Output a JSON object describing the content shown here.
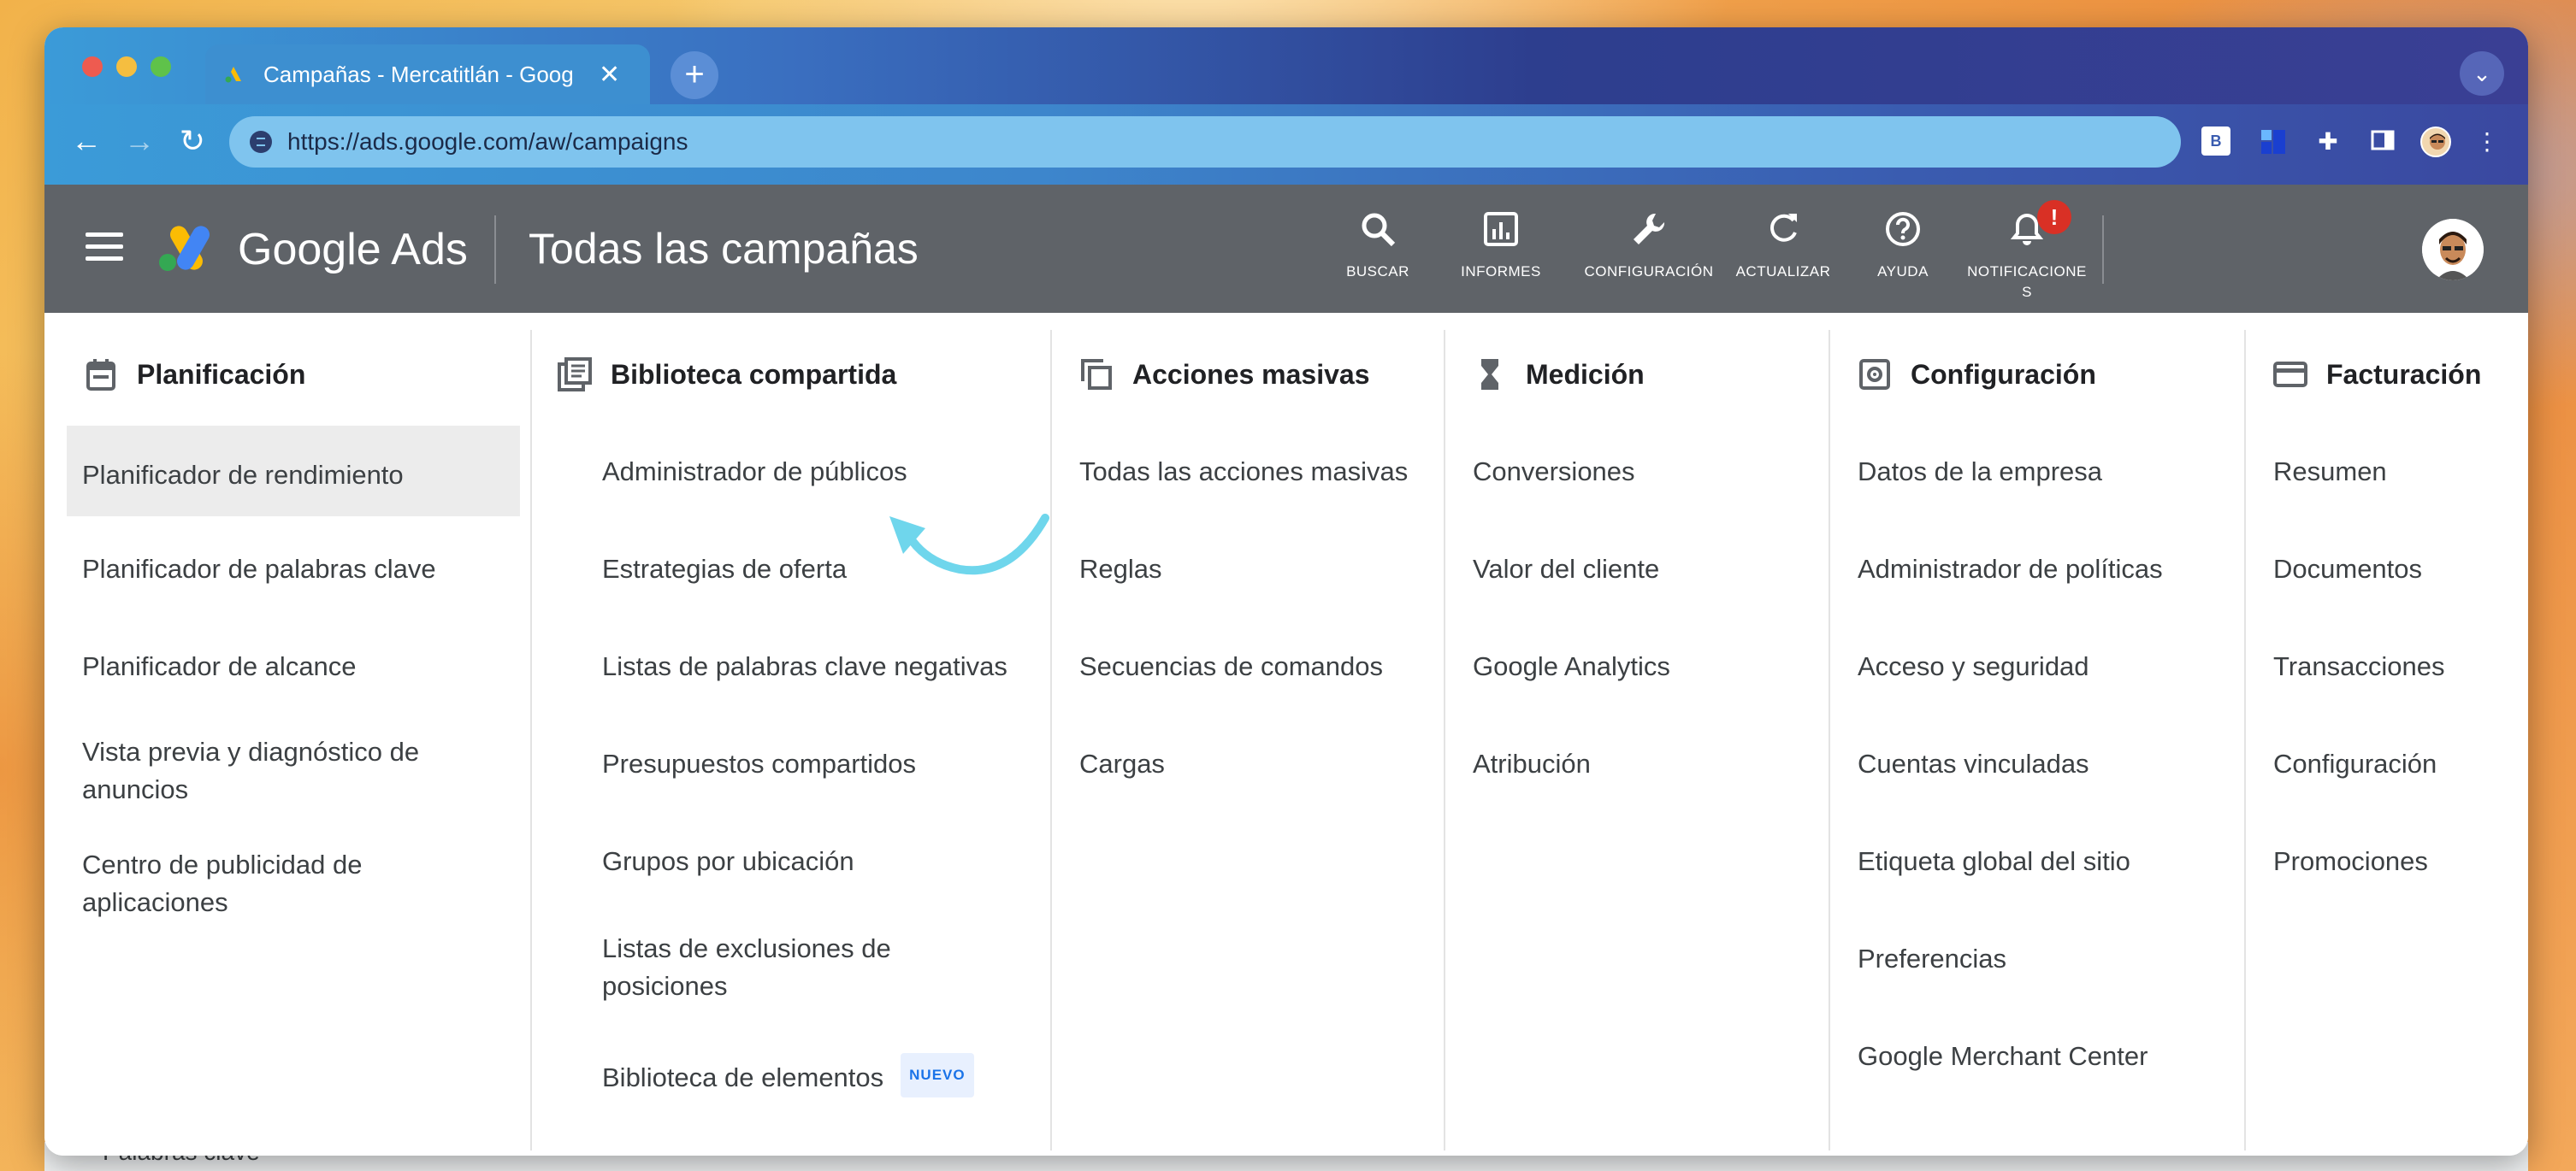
{
  "browser": {
    "tab_title": "Campañas - Mercatitlán - Goog",
    "url": "https://ads.google.com/aw/campaigns",
    "ext_b_label": "B"
  },
  "header": {
    "brand": "Google Ads",
    "page_title": "Todas las campañas",
    "actions": [
      {
        "label": "BUSCAR",
        "icon": "search-icon"
      },
      {
        "label": "INFORMES",
        "icon": "reports-icon"
      },
      {
        "label": "CONFIGURACIÓN",
        "icon": "wrench-icon"
      },
      {
        "label": "ACTUALIZAR",
        "icon": "refresh-icon"
      },
      {
        "label": "AYUDA",
        "icon": "help-icon"
      },
      {
        "label": "NOTIFICACIONE\nS",
        "icon": "bell-icon"
      }
    ],
    "notification_badge": "!"
  },
  "menu": {
    "planificacion": {
      "title": "Planificación",
      "items": [
        "Planificador de rendimiento",
        "Planificador de palabras clave",
        "Planificador de alcance",
        "Vista previa y diagnóstico de anuncios",
        "Centro de publicidad de aplicaciones"
      ]
    },
    "biblioteca": {
      "title": "Biblioteca compartida",
      "items": [
        "Administrador de públicos",
        "Estrategias de oferta",
        "Listas de palabras clave negativas",
        "Presupuestos compartidos",
        "Grupos por ubicación",
        "Listas de exclusiones de posiciones",
        "Biblioteca de elementos"
      ],
      "new_badge": "NUEVO"
    },
    "acciones": {
      "title": "Acciones masivas",
      "items": [
        "Todas las acciones masivas",
        "Reglas",
        "Secuencias de comandos",
        "Cargas"
      ]
    },
    "medicion": {
      "title": "Medición",
      "items": [
        "Conversiones",
        "Valor del cliente",
        "Google Analytics",
        "Atribución"
      ]
    },
    "configuracion": {
      "title": "Configuración",
      "items": [
        "Datos de la empresa",
        "Administrador de políticas",
        "Acceso y seguridad",
        "Cuentas vinculadas",
        "Etiqueta global del sitio",
        "Preferencias",
        "Google Merchant Center"
      ]
    },
    "facturacion": {
      "title": "Facturación",
      "items": [
        "Resumen",
        "Documentos",
        "Transacciones",
        "Configuración",
        "Promociones"
      ]
    }
  },
  "background": {
    "partial_text": "Palabras clave"
  },
  "colors": {
    "header_bg": "#5f6368",
    "accent": "#1a73e8",
    "annotation_arrow": "#6fd6ec"
  }
}
